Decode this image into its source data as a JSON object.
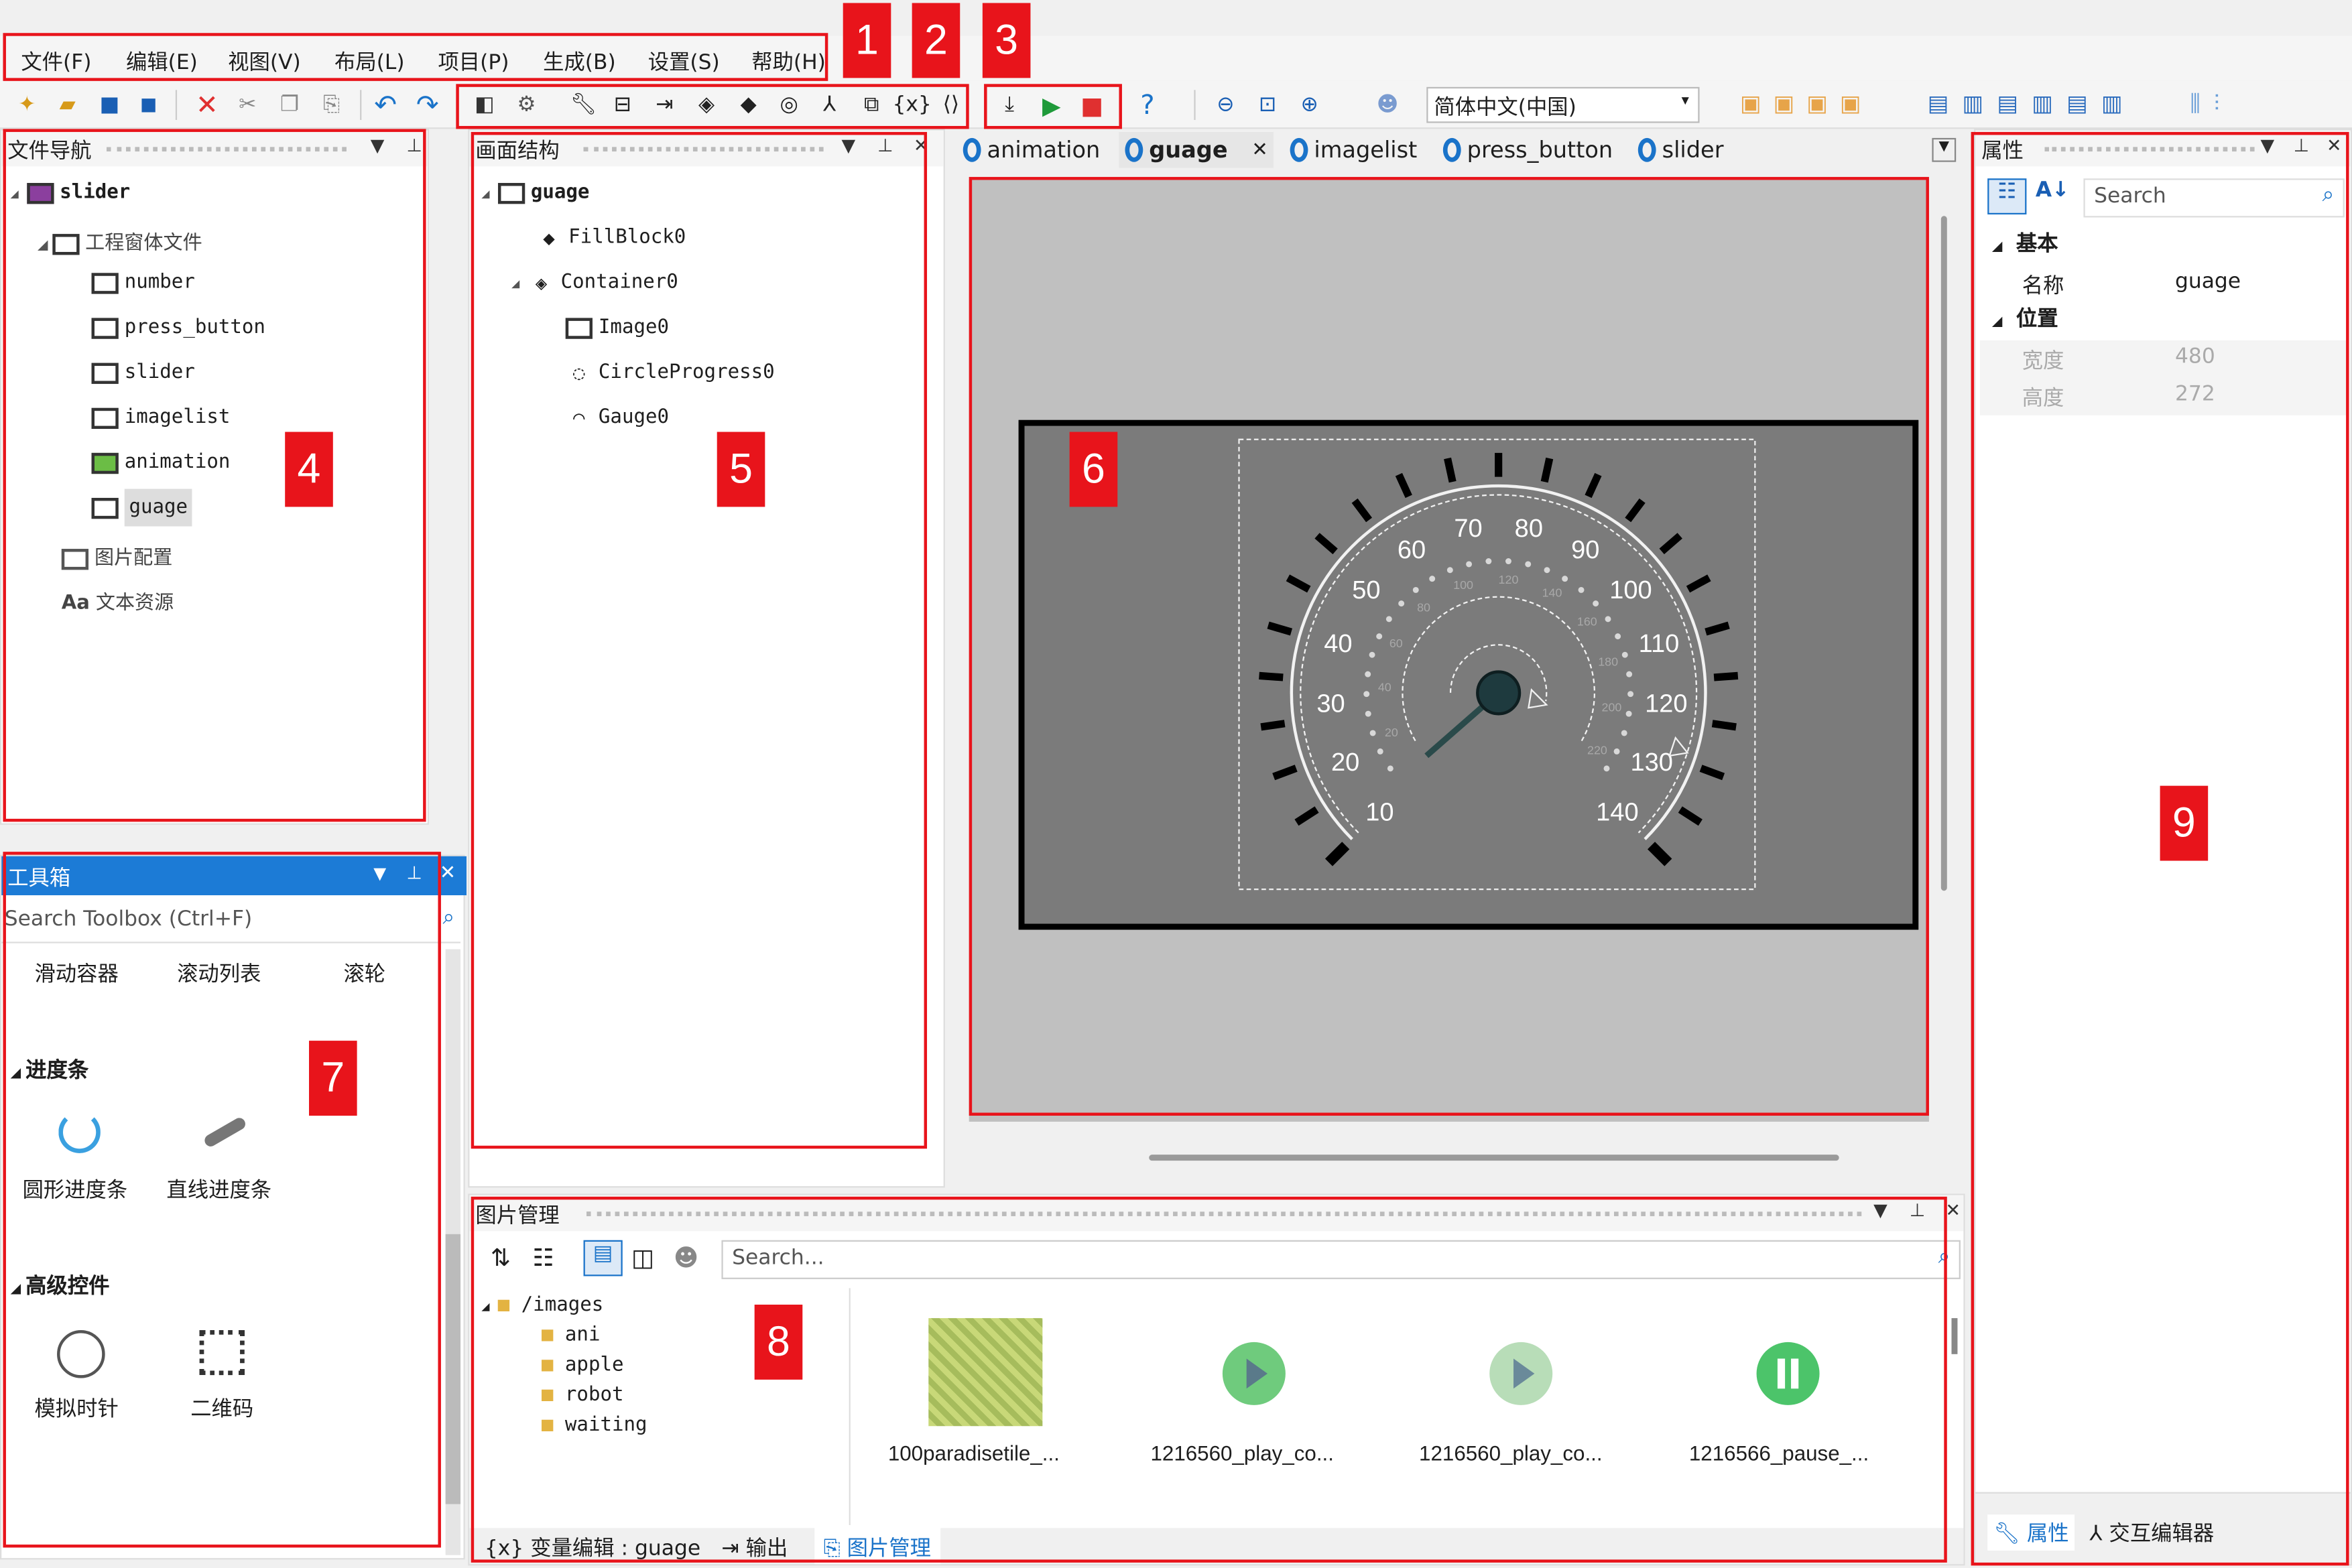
{
  "menu": [
    "文件(F)",
    "编辑(E)",
    "视图(V)",
    "布局(L)",
    "项目(P)",
    "生成(B)",
    "设置(S)",
    "帮助(H)"
  ],
  "badges": [
    "1",
    "2",
    "3",
    "4",
    "5",
    "6",
    "7",
    "8",
    "9"
  ],
  "toolbar": {
    "language": "简体中文(中国)",
    "icons": [
      "new-file-icon",
      "open-icon",
      "save-icon",
      "save-all-icon",
      "delete-icon",
      "cut-icon",
      "copy-icon",
      "paste-icon",
      "undo-icon",
      "redo-icon",
      "compile-icon",
      "settings-icon",
      "wrench-icon",
      "toolbox-icon",
      "export-icon",
      "build-icon",
      "deploy-icon",
      "resource-icon",
      "tree-icon",
      "copy-window-icon",
      "variable-icon",
      "event-icon",
      "download-icon",
      "run-icon",
      "stop-icon",
      "help-icon",
      "zoom-out-icon",
      "zoom-fit-icon",
      "zoom-in-icon",
      "user-icon"
    ]
  },
  "file_nav": {
    "title": "文件导航",
    "root": "slider",
    "folder": "工程窗体文件",
    "items": [
      "number",
      "press_button",
      "slider",
      "imagelist",
      "animation",
      "guage"
    ],
    "image_config": "图片配置",
    "text_res": "文本资源"
  },
  "structure": {
    "title": "画面结构",
    "root": "guage",
    "items": [
      "FillBlock0",
      "Container0",
      "Image0",
      "CircleProgress0",
      "Gauge0"
    ]
  },
  "tabs": [
    "animation",
    "guage",
    "imagelist",
    "press_button",
    "slider"
  ],
  "gauge": {
    "labels": [
      "10",
      "20",
      "30",
      "40",
      "50",
      "60",
      "70",
      "80",
      "90",
      "100",
      "110",
      "120",
      "130",
      "140"
    ],
    "inner_labels": [
      "20",
      "40",
      "60",
      "80",
      "100",
      "120",
      "140",
      "160",
      "180",
      "200",
      "220"
    ]
  },
  "toolbox": {
    "title": "工具箱",
    "search_placeholder": "Search Toolbox (Ctrl+F)",
    "row1": [
      "滑动容器",
      "滚动列表",
      "滚轮"
    ],
    "section1": "进度条",
    "items1": [
      "圆形进度条",
      "直线进度条"
    ],
    "section2": "高级控件",
    "items2": [
      "模拟时针",
      "二维码"
    ]
  },
  "image_mgr": {
    "title": "图片管理",
    "search_placeholder": "Search...",
    "root": "/images",
    "folders": [
      "ani",
      "apple",
      "robot",
      "waiting"
    ],
    "files": [
      "100paradisetile_...",
      "1216560_play_co...",
      "1216560_play_co...",
      "1216566_pause_..."
    ],
    "bottom_tabs": [
      "变量编辑 : guage",
      "输出",
      "图片管理"
    ]
  },
  "props": {
    "title": "属性",
    "search_placeholder": "Search",
    "basic": "基本",
    "name_label": "名称",
    "name_value": "guage",
    "position": "位置",
    "width_label": "宽度",
    "width_value": "480",
    "height_label": "高度",
    "height_value": "272",
    "bottom_tabs": [
      "属性",
      "交互编辑器"
    ]
  },
  "colors": {
    "accent": "#1a73c9",
    "red": "#e8141b",
    "gauge_bg": "#7b7b7b",
    "canvas_bg": "#c0c0c0"
  }
}
